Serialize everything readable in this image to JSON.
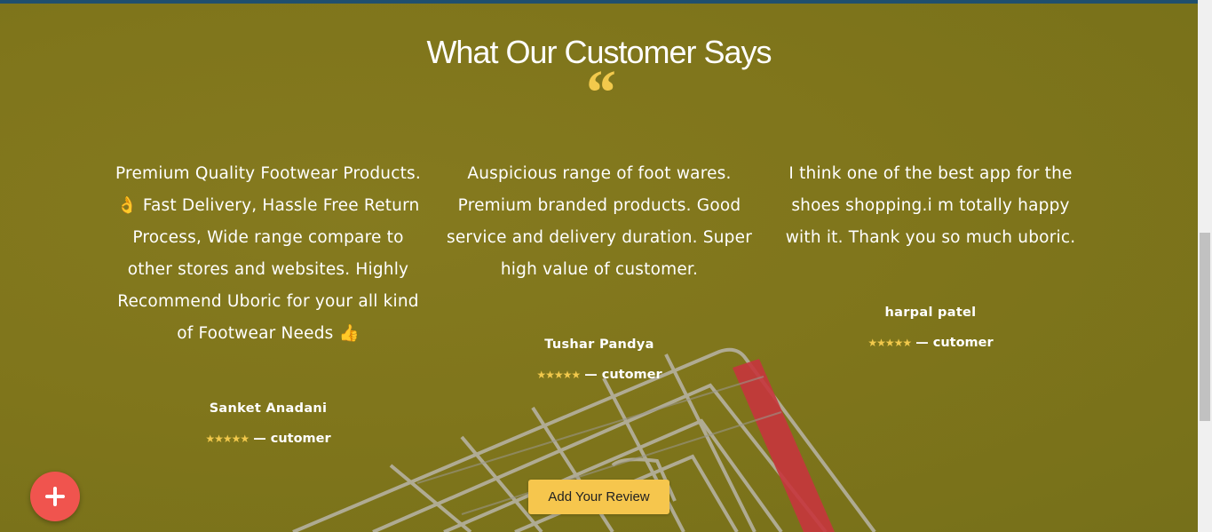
{
  "section": {
    "title": "What Our Customer Says",
    "quote_glyph": "“"
  },
  "reviews": [
    {
      "lines": [
        "Premium Quality Footwear Products.",
        "👌 Fast Delivery, Hassle Free Return",
        "Process, Wide range compare to",
        "other stores and websites. Highly",
        "Recommend Uboric for your all kind",
        "of Footwear Needs 👍"
      ],
      "name": "Sanket Anadani",
      "stars": "★★★★★",
      "role": "— cutomer"
    },
    {
      "lines": [
        "Auspicious range of foot wares.",
        "Premium branded products. Good",
        "service and delivery duration. Super",
        "high value of customer."
      ],
      "name": "Tushar Pandya",
      "stars": "★★★★★",
      "role": "— cutomer"
    },
    {
      "lines": [
        "I think one of the best app for the",
        "shoes shopping.i m totally happy",
        "with it. Thank you so much uboric."
      ],
      "name": "harpal patel",
      "stars": "★★★★★",
      "role": "— cutomer"
    }
  ],
  "actions": {
    "add_review_label": "Add Your Review",
    "fab_icon": "plus-icon"
  },
  "colors": {
    "background": "#7d741b",
    "accent": "#f6c64d",
    "fab": "#f0544e",
    "top_bar": "#1f4f6e"
  }
}
